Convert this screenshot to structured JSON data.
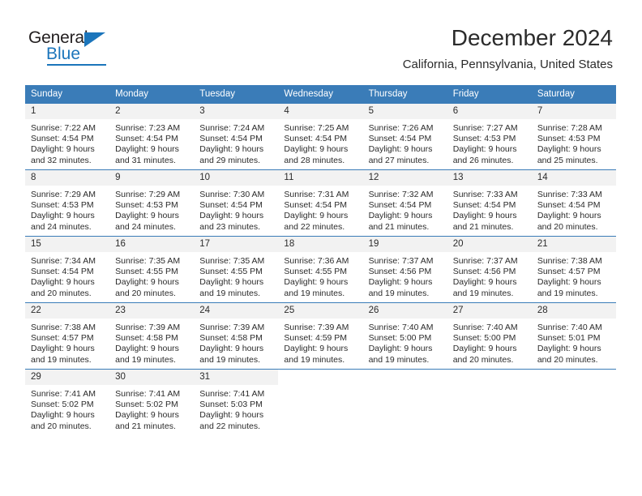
{
  "brand": {
    "name_top": "General",
    "name_bottom": "Blue",
    "accent_color": "#1b75bb"
  },
  "header": {
    "month_title": "December 2024",
    "location": "California, Pennsylvania, United States"
  },
  "theme": {
    "header_bg": "#3a7cb8",
    "daynum_bg": "#f2f2f2",
    "text_color": "#2b2b2b"
  },
  "weekday_headers": [
    "Sunday",
    "Monday",
    "Tuesday",
    "Wednesday",
    "Thursday",
    "Friday",
    "Saturday"
  ],
  "weeks": [
    [
      {
        "day": "1",
        "sunrise": "Sunrise: 7:22 AM",
        "sunset": "Sunset: 4:54 PM",
        "daylight1": "Daylight: 9 hours",
        "daylight2": "and 32 minutes."
      },
      {
        "day": "2",
        "sunrise": "Sunrise: 7:23 AM",
        "sunset": "Sunset: 4:54 PM",
        "daylight1": "Daylight: 9 hours",
        "daylight2": "and 31 minutes."
      },
      {
        "day": "3",
        "sunrise": "Sunrise: 7:24 AM",
        "sunset": "Sunset: 4:54 PM",
        "daylight1": "Daylight: 9 hours",
        "daylight2": "and 29 minutes."
      },
      {
        "day": "4",
        "sunrise": "Sunrise: 7:25 AM",
        "sunset": "Sunset: 4:54 PM",
        "daylight1": "Daylight: 9 hours",
        "daylight2": "and 28 minutes."
      },
      {
        "day": "5",
        "sunrise": "Sunrise: 7:26 AM",
        "sunset": "Sunset: 4:54 PM",
        "daylight1": "Daylight: 9 hours",
        "daylight2": "and 27 minutes."
      },
      {
        "day": "6",
        "sunrise": "Sunrise: 7:27 AM",
        "sunset": "Sunset: 4:53 PM",
        "daylight1": "Daylight: 9 hours",
        "daylight2": "and 26 minutes."
      },
      {
        "day": "7",
        "sunrise": "Sunrise: 7:28 AM",
        "sunset": "Sunset: 4:53 PM",
        "daylight1": "Daylight: 9 hours",
        "daylight2": "and 25 minutes."
      }
    ],
    [
      {
        "day": "8",
        "sunrise": "Sunrise: 7:29 AM",
        "sunset": "Sunset: 4:53 PM",
        "daylight1": "Daylight: 9 hours",
        "daylight2": "and 24 minutes."
      },
      {
        "day": "9",
        "sunrise": "Sunrise: 7:29 AM",
        "sunset": "Sunset: 4:53 PM",
        "daylight1": "Daylight: 9 hours",
        "daylight2": "and 24 minutes."
      },
      {
        "day": "10",
        "sunrise": "Sunrise: 7:30 AM",
        "sunset": "Sunset: 4:54 PM",
        "daylight1": "Daylight: 9 hours",
        "daylight2": "and 23 minutes."
      },
      {
        "day": "11",
        "sunrise": "Sunrise: 7:31 AM",
        "sunset": "Sunset: 4:54 PM",
        "daylight1": "Daylight: 9 hours",
        "daylight2": "and 22 minutes."
      },
      {
        "day": "12",
        "sunrise": "Sunrise: 7:32 AM",
        "sunset": "Sunset: 4:54 PM",
        "daylight1": "Daylight: 9 hours",
        "daylight2": "and 21 minutes."
      },
      {
        "day": "13",
        "sunrise": "Sunrise: 7:33 AM",
        "sunset": "Sunset: 4:54 PM",
        "daylight1": "Daylight: 9 hours",
        "daylight2": "and 21 minutes."
      },
      {
        "day": "14",
        "sunrise": "Sunrise: 7:33 AM",
        "sunset": "Sunset: 4:54 PM",
        "daylight1": "Daylight: 9 hours",
        "daylight2": "and 20 minutes."
      }
    ],
    [
      {
        "day": "15",
        "sunrise": "Sunrise: 7:34 AM",
        "sunset": "Sunset: 4:54 PM",
        "daylight1": "Daylight: 9 hours",
        "daylight2": "and 20 minutes."
      },
      {
        "day": "16",
        "sunrise": "Sunrise: 7:35 AM",
        "sunset": "Sunset: 4:55 PM",
        "daylight1": "Daylight: 9 hours",
        "daylight2": "and 20 minutes."
      },
      {
        "day": "17",
        "sunrise": "Sunrise: 7:35 AM",
        "sunset": "Sunset: 4:55 PM",
        "daylight1": "Daylight: 9 hours",
        "daylight2": "and 19 minutes."
      },
      {
        "day": "18",
        "sunrise": "Sunrise: 7:36 AM",
        "sunset": "Sunset: 4:55 PM",
        "daylight1": "Daylight: 9 hours",
        "daylight2": "and 19 minutes."
      },
      {
        "day": "19",
        "sunrise": "Sunrise: 7:37 AM",
        "sunset": "Sunset: 4:56 PM",
        "daylight1": "Daylight: 9 hours",
        "daylight2": "and 19 minutes."
      },
      {
        "day": "20",
        "sunrise": "Sunrise: 7:37 AM",
        "sunset": "Sunset: 4:56 PM",
        "daylight1": "Daylight: 9 hours",
        "daylight2": "and 19 minutes."
      },
      {
        "day": "21",
        "sunrise": "Sunrise: 7:38 AM",
        "sunset": "Sunset: 4:57 PM",
        "daylight1": "Daylight: 9 hours",
        "daylight2": "and 19 minutes."
      }
    ],
    [
      {
        "day": "22",
        "sunrise": "Sunrise: 7:38 AM",
        "sunset": "Sunset: 4:57 PM",
        "daylight1": "Daylight: 9 hours",
        "daylight2": "and 19 minutes."
      },
      {
        "day": "23",
        "sunrise": "Sunrise: 7:39 AM",
        "sunset": "Sunset: 4:58 PM",
        "daylight1": "Daylight: 9 hours",
        "daylight2": "and 19 minutes."
      },
      {
        "day": "24",
        "sunrise": "Sunrise: 7:39 AM",
        "sunset": "Sunset: 4:58 PM",
        "daylight1": "Daylight: 9 hours",
        "daylight2": "and 19 minutes."
      },
      {
        "day": "25",
        "sunrise": "Sunrise: 7:39 AM",
        "sunset": "Sunset: 4:59 PM",
        "daylight1": "Daylight: 9 hours",
        "daylight2": "and 19 minutes."
      },
      {
        "day": "26",
        "sunrise": "Sunrise: 7:40 AM",
        "sunset": "Sunset: 5:00 PM",
        "daylight1": "Daylight: 9 hours",
        "daylight2": "and 19 minutes."
      },
      {
        "day": "27",
        "sunrise": "Sunrise: 7:40 AM",
        "sunset": "Sunset: 5:00 PM",
        "daylight1": "Daylight: 9 hours",
        "daylight2": "and 20 minutes."
      },
      {
        "day": "28",
        "sunrise": "Sunrise: 7:40 AM",
        "sunset": "Sunset: 5:01 PM",
        "daylight1": "Daylight: 9 hours",
        "daylight2": "and 20 minutes."
      }
    ],
    [
      {
        "day": "29",
        "sunrise": "Sunrise: 7:41 AM",
        "sunset": "Sunset: 5:02 PM",
        "daylight1": "Daylight: 9 hours",
        "daylight2": "and 20 minutes."
      },
      {
        "day": "30",
        "sunrise": "Sunrise: 7:41 AM",
        "sunset": "Sunset: 5:02 PM",
        "daylight1": "Daylight: 9 hours",
        "daylight2": "and 21 minutes."
      },
      {
        "day": "31",
        "sunrise": "Sunrise: 7:41 AM",
        "sunset": "Sunset: 5:03 PM",
        "daylight1": "Daylight: 9 hours",
        "daylight2": "and 22 minutes."
      },
      {
        "day": "",
        "sunrise": "",
        "sunset": "",
        "daylight1": "",
        "daylight2": ""
      },
      {
        "day": "",
        "sunrise": "",
        "sunset": "",
        "daylight1": "",
        "daylight2": ""
      },
      {
        "day": "",
        "sunrise": "",
        "sunset": "",
        "daylight1": "",
        "daylight2": ""
      },
      {
        "day": "",
        "sunrise": "",
        "sunset": "",
        "daylight1": "",
        "daylight2": ""
      }
    ]
  ]
}
